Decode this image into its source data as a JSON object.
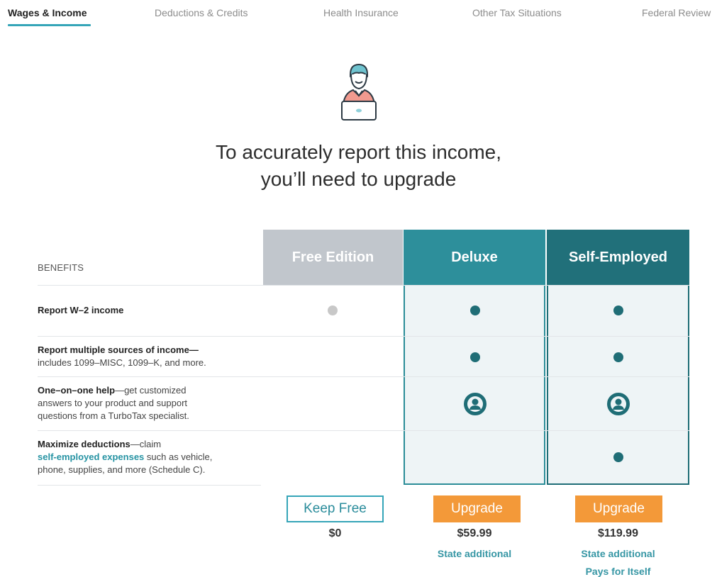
{
  "tabs": [
    {
      "label": "Wages & Income",
      "active": true
    },
    {
      "label": "Deductions & Credits"
    },
    {
      "label": "Health Insurance"
    },
    {
      "label": "Other Tax Situations"
    },
    {
      "label": "Federal Review"
    }
  ],
  "hero_icon": "person-at-laptop-icon",
  "headline": {
    "line1": "To accurately report this income,",
    "line2": "you’ll need to upgrade"
  },
  "table": {
    "benefits_header": "BENEFITS",
    "plans": [
      {
        "name": "Free Edition",
        "color": "#c1c6cc"
      },
      {
        "name": "Deluxe",
        "color": "#2d8f9b"
      },
      {
        "name": "Self-Employed",
        "color": "#21707a"
      }
    ],
    "rows": [
      {
        "title": "Report W–2 income",
        "desc": "",
        "free": "dot-gray",
        "deluxe": "dot",
        "self_employed": "dot"
      },
      {
        "title": "Report multiple sources of income—",
        "desc": "includes 1099–MISC, 1099–K, and more.",
        "free": "",
        "deluxe": "dot",
        "self_employed": "dot"
      },
      {
        "title": "One–on–one help",
        "desc_lead": "—get customized",
        "desc": "answers to your product and support",
        "desc2": "questions from a TurboTax specialist.",
        "free": "",
        "deluxe": "person-help-icon",
        "self_employed": "person-help-icon"
      },
      {
        "title": "Maximize deductions",
        "desc_lead": "—claim",
        "link": "self-employed expenses",
        "desc": " such as vehicle,",
        "desc2": "phone, supplies, and more (Schedule C).",
        "free": "",
        "deluxe": "",
        "self_employed": "dot"
      }
    ]
  },
  "actions": {
    "free": {
      "button": "Keep Free",
      "price": "$0"
    },
    "deluxe": {
      "button": "Upgrade",
      "price": "$59.99",
      "note": "State additional"
    },
    "self_employed": {
      "button": "Upgrade",
      "price": "$119.99",
      "note": "State additional",
      "note2": "Pays for Itself"
    }
  },
  "colors": {
    "accent": "#35a5b8",
    "orange": "#f39939",
    "teal_dark": "#1f6d76"
  }
}
